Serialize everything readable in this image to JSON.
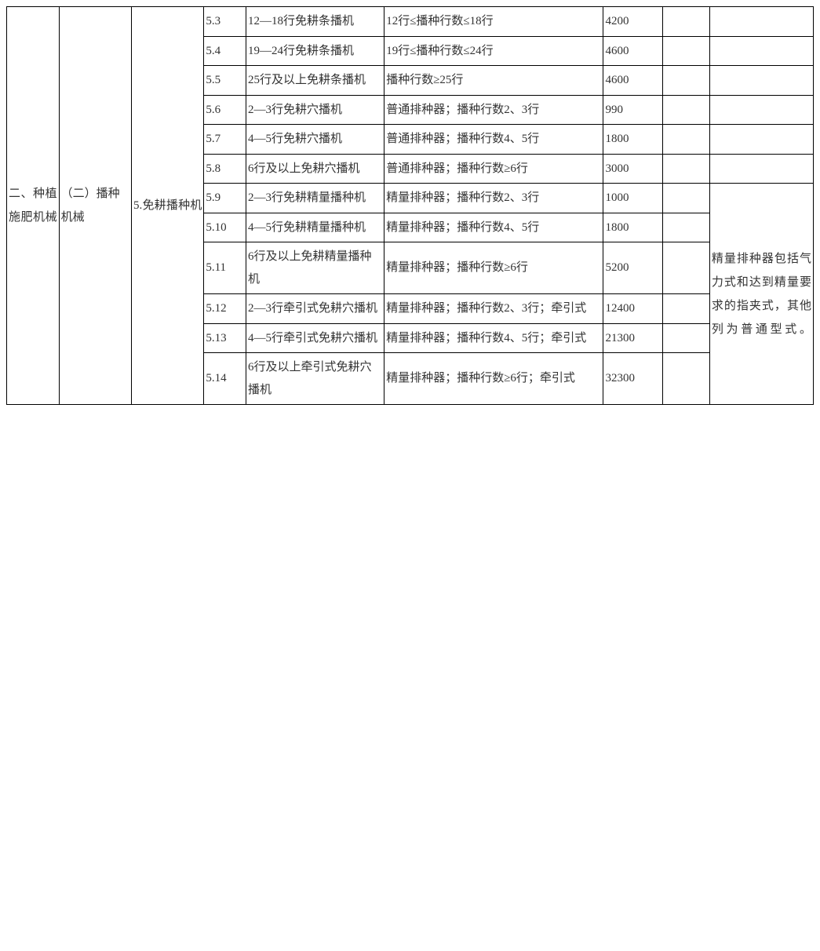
{
  "category": "二、种植施肥机械",
  "subcategory": "（二）播种机械",
  "group": "5.免耕播种机",
  "note_5_9_14": "精量排种器包括气力式和达到精量要求的指夹式，其他列为普通型式。",
  "rows": [
    {
      "code": "5.3",
      "name": "12—18行免耕条播机",
      "spec": "12行≤播种行数≤18行",
      "subsidy": "4200",
      "blank": ""
    },
    {
      "code": "5.4",
      "name": "19—24行免耕条播机",
      "spec": "19行≤播种行数≤24行",
      "subsidy": "4600",
      "blank": ""
    },
    {
      "code": "5.5",
      "name": "25行及以上免耕条播机",
      "spec": "播种行数≥25行",
      "subsidy": "4600",
      "blank": ""
    },
    {
      "code": "5.6",
      "name": "2—3行免耕穴播机",
      "spec": "普通排种器；播种行数2、3行",
      "subsidy": "990",
      "blank": ""
    },
    {
      "code": "5.7",
      "name": "4—5行免耕穴播机",
      "spec": "普通排种器；播种行数4、5行",
      "subsidy": "1800",
      "blank": ""
    },
    {
      "code": "5.8",
      "name": "6行及以上免耕穴播机",
      "spec": "普通排种器；播种行数≥6行",
      "subsidy": "3000",
      "blank": ""
    },
    {
      "code": "5.9",
      "name": "2—3行免耕精量播种机",
      "spec": "精量排种器；播种行数2、3行",
      "subsidy": "1000",
      "blank": ""
    },
    {
      "code": "5.10",
      "name": "4—5行免耕精量播种机",
      "spec": "精量排种器；播种行数4、5行",
      "subsidy": "1800",
      "blank": ""
    },
    {
      "code": "5.11",
      "name": "6行及以上免耕精量播种机",
      "spec": "精量排种器；播种行数≥6行",
      "subsidy": "5200",
      "blank": ""
    },
    {
      "code": "5.12",
      "name": "2—3行牵引式免耕穴播机",
      "spec": "精量排种器；播种行数2、3行；牵引式",
      "subsidy": "12400",
      "blank": ""
    },
    {
      "code": "5.13",
      "name": "4—5行牵引式免耕穴播机",
      "spec": "精量排种器；播种行数4、5行；牵引式",
      "subsidy": "21300",
      "blank": ""
    },
    {
      "code": "5.14",
      "name": "6行及以上牵引式免耕穴播机",
      "spec": "精量排种器；播种行数≥6行；牵引式",
      "subsidy": "32300",
      "blank": ""
    }
  ]
}
